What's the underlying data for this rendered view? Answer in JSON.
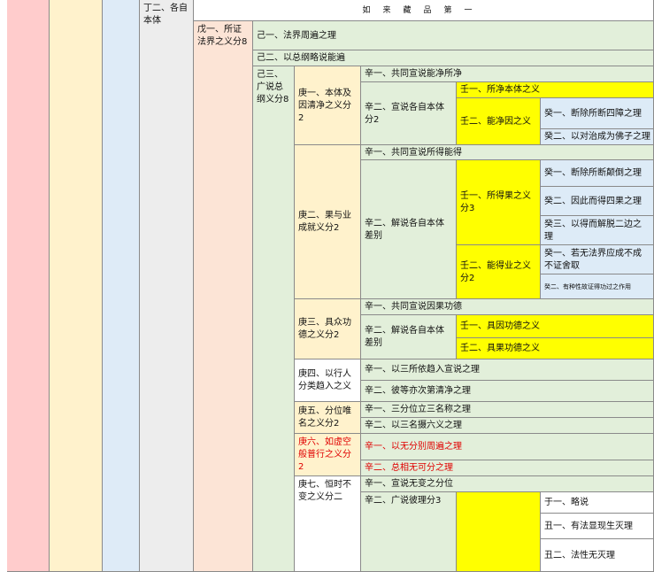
{
  "col_a": "",
  "col_b": "",
  "col_c": "",
  "ding2": "丁二、各自本体",
  "title": "如来藏品第一",
  "wu1": "戊一、所证法界之义分8",
  "ji1": "己一、法界周遍之理",
  "ji2": "己二、以总纲略说能遍",
  "ji3": "己三、广说总纲义分8",
  "geng1": "庚一、本体及因清净之义分2",
  "geng2": "庚二、果与业成就义分2",
  "geng3": "庚三、具众功德之义分2",
  "geng4": "庚四、以行人分类趋入之义",
  "geng5": "庚五、分位唯名之义分2",
  "geng6": "庚六、如虚空般普行之义分2",
  "geng7": "庚七、恒时不变之义分二",
  "g1_xin1": "辛一、共同宣说能净所净",
  "g1_xin2": "辛二、宣说各自本体分2",
  "g1_ren1": "壬一、所净本体之义",
  "g1_ren2": "壬二、能净因之义",
  "g1_gui1": "癸一、断除所断四障之理",
  "g1_gui2": "癸二、以对治成为佛子之理",
  "g2_xin1": "辛一、共同宣说所得能得",
  "g2_xin2": "辛二、解说各自本体差别",
  "g2_ren1": "壬一、所得果之义分3",
  "g2_ren2": "壬二、能得业之义分2",
  "g2_gui1": "癸一、断除所断颠倒之理",
  "g2_gui2": "癸二、因此而得四果之理",
  "g2_gui3": "癸三、以得而解脱二边之理",
  "g2_gui4": "癸一、若无法界应成不成不证舍取",
  "g2_gui5": "癸二、有种性故证得功过之作用",
  "g3_xin1": "辛一、共同宣说因果功德",
  "g3_xin2": "辛二、解说各自本体差别",
  "g3_ren1": "壬一、具因功德之义",
  "g3_ren2": "壬二、具果功德之义",
  "g4_xin1": "辛一、以三所依趋入宣说之理",
  "g4_xin2": "辛二、彼等亦次第清净之理",
  "g5_xin1": "辛一、三分位立三名称之理",
  "g5_xin2": "辛二、以三名摄六义之理",
  "g6_xin1": "辛一、以无分别周遍之理",
  "g6_xin2": "辛二、总相无可分之理",
  "g7_xin1": "辛一、宣说无变之分位",
  "g7_xin2": "辛二、广说彼理分3",
  "g7_ren": "",
  "g7_yu1": "于一、略说",
  "g7_chou1": "丑一、有法显现生灭理",
  "g7_chou2": "丑二、法性无灭理"
}
